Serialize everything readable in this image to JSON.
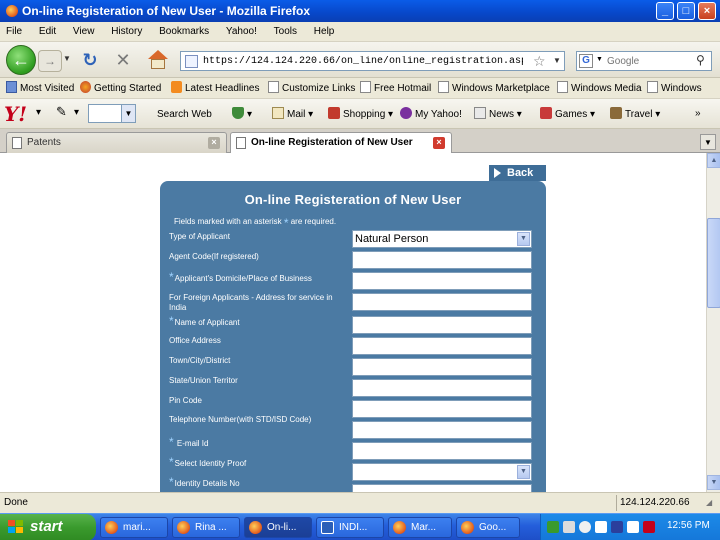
{
  "window": {
    "title": "On-line Registeration of New User - Mozilla Firefox",
    "minimize": "_",
    "maximize": "□",
    "close": "×"
  },
  "menu": [
    "File",
    "Edit",
    "View",
    "History",
    "Bookmarks",
    "Yahoo!",
    "Tools",
    "Help"
  ],
  "nav": {
    "url": "https://124.124.220.66/on_line/online_registration.aspx",
    "search_placeholder": "Google",
    "back_glyph": "←",
    "forward_glyph": "→",
    "reload_glyph": "↻",
    "stop_glyph": "✕"
  },
  "bookmarks": [
    "Most Visited",
    "Getting Started",
    "Latest Headlines",
    "Customize Links",
    "Free Hotmail",
    "Windows Marketplace",
    "Windows Media",
    "Windows"
  ],
  "yahoo_toolbar": {
    "logo": "Y!",
    "items": [
      "Search Web",
      "Mail",
      "Shopping",
      "My Yahoo!",
      "News",
      "Games",
      "Travel"
    ]
  },
  "tabs": [
    {
      "label": "Patents",
      "active": false
    },
    {
      "label": "On-line Registeration of New User",
      "active": true
    }
  ],
  "page": {
    "back_label": "Back",
    "form_title": "On-line Registeration of New User",
    "required_note_prefix": "Fields marked with an asterisk",
    "required_note_suffix": "are required.",
    "asterisk": "*",
    "fields": [
      {
        "label": "Type of Applicant",
        "required": false,
        "type": "select",
        "value": "Natural Person"
      },
      {
        "label": "Agent Code(If registered)",
        "required": false,
        "type": "text",
        "value": ""
      },
      {
        "label": "Applicant's Domicile/Place of Business",
        "required": true,
        "type": "text",
        "value": ""
      },
      {
        "label": "For Foreign Applicants - Address for service in India",
        "required": false,
        "type": "text",
        "value": ""
      },
      {
        "label": "Name of Applicant",
        "required": true,
        "type": "text",
        "value": ""
      },
      {
        "label": "Office Address",
        "required": false,
        "type": "text",
        "value": ""
      },
      {
        "label": "Town/City/District",
        "required": false,
        "type": "text",
        "value": ""
      },
      {
        "label": "State/Union Territor",
        "required": false,
        "type": "text",
        "value": ""
      },
      {
        "label": "Pin Code",
        "required": false,
        "type": "text",
        "value": ""
      },
      {
        "label": "Telephone Number(with STD/ISD Code)",
        "required": false,
        "type": "text",
        "value": ""
      },
      {
        "label": "E-mail Id",
        "required": true,
        "type": "text",
        "value": ""
      },
      {
        "label": "Select Identity Proof",
        "required": true,
        "type": "select",
        "value": ""
      },
      {
        "label": "Identity Details No",
        "required": true,
        "type": "text",
        "value": ""
      }
    ]
  },
  "status": {
    "text": "Done",
    "host": "124.124.220.66"
  },
  "taskbar": {
    "start": "start",
    "tasks": [
      {
        "label": "mari...",
        "icon": "firefox"
      },
      {
        "label": "Rina ...",
        "icon": "firefox"
      },
      {
        "label": "On-li...",
        "icon": "firefox",
        "active": true
      },
      {
        "label": "INDI...",
        "icon": "word"
      },
      {
        "label": "Mar...",
        "icon": "firefox"
      },
      {
        "label": "Goo...",
        "icon": "firefox"
      }
    ],
    "clock": "12:56 PM"
  },
  "colors": {
    "panel": "#4b7aa3",
    "back_link": "#3e6d97",
    "asterisk": "#9fd3ff",
    "titlebar": "#0a5ce8"
  }
}
